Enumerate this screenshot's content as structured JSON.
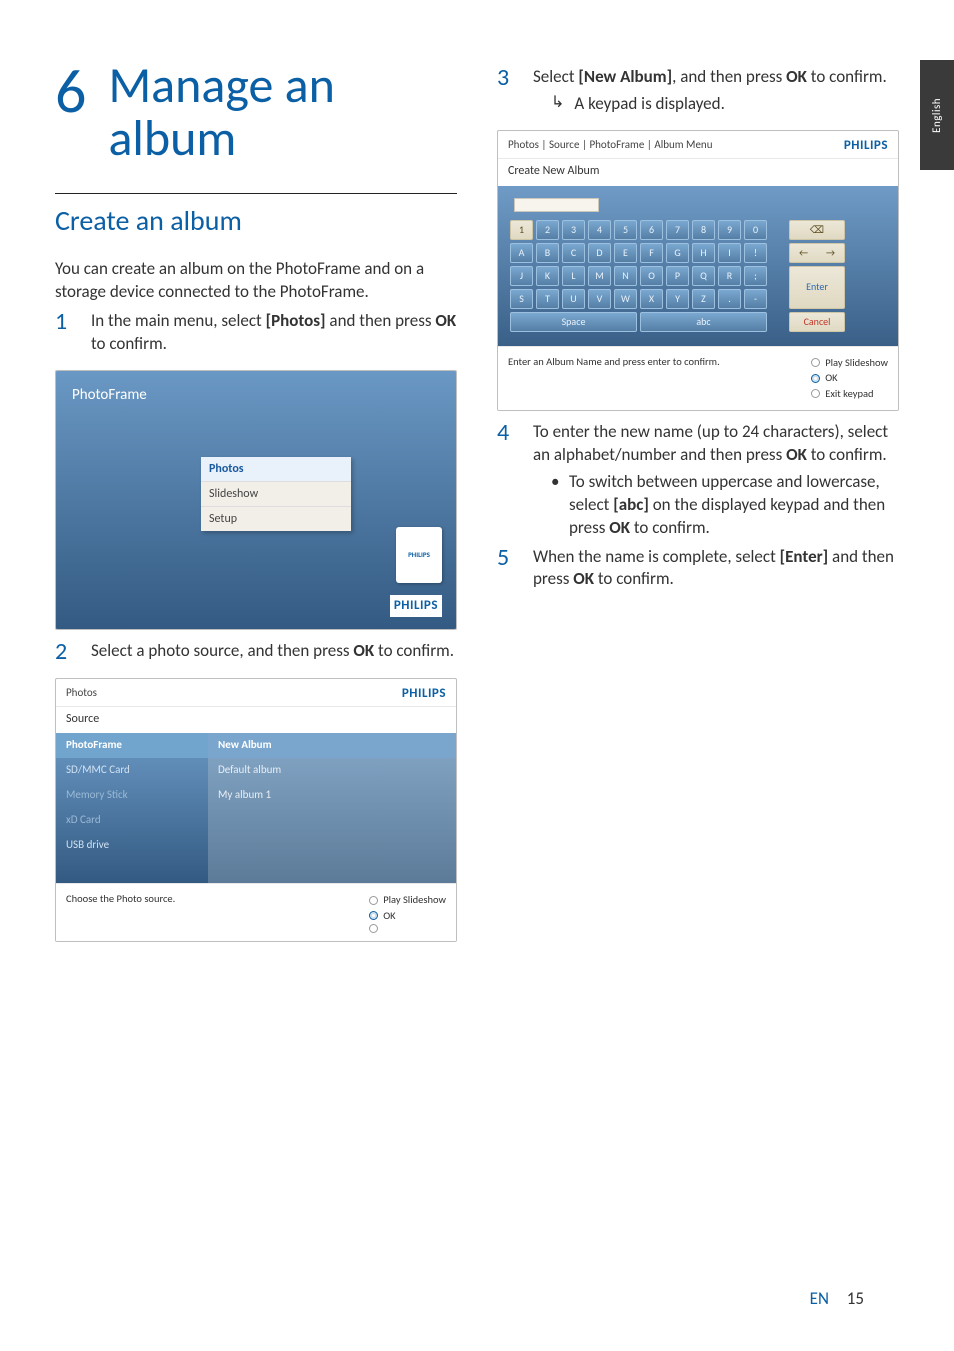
{
  "sideTab": "English",
  "chapter": {
    "number": "6",
    "title_line1": "Manage an",
    "title_line2": "album"
  },
  "section": {
    "title": "Create an album"
  },
  "intro": "You can create an album on the PhotoFrame and on a storage device connected to the PhotoFrame.",
  "steps": {
    "s1_a": "In the main menu, select ",
    "s1_bold": "[Photos]",
    "s1_b": " and then press ",
    "s1_ok": "OK",
    "s1_c": " to confirm.",
    "s2_a": "Select a photo source, and then press ",
    "s2_ok": "OK",
    "s2_b": " to confirm.",
    "s3_a": "Select ",
    "s3_bold": "[New Album]",
    "s3_b": ", and then press ",
    "s3_ok": "OK",
    "s3_c": " to confirm.",
    "s3_result": "A keypad is displayed.",
    "s4_a": "To enter the new name (up to 24 characters), select an alphabet/number and then press ",
    "s4_ok": "OK",
    "s4_b": " to confirm.",
    "s4_bullet_a": "To switch between uppercase and lowercase, select ",
    "s4_bullet_bold": "[abc]",
    "s4_bullet_b": " on the displayed keypad and then press ",
    "s4_bullet_ok": "OK",
    "s4_bullet_c": " to confirm.",
    "s5_a": "When the name is complete, select ",
    "s5_bold": "[Enter]",
    "s5_b": " and then press ",
    "s5_ok": "OK",
    "s5_c": " to confirm."
  },
  "shot1": {
    "title": "PhotoFrame",
    "menu": [
      "Photos",
      "Slideshow",
      "Setup"
    ],
    "frameLogo": "PHILIPS",
    "brand": "PHILIPS"
  },
  "shot2": {
    "breadcrumb": "Photos",
    "brand": "PHILIPS",
    "subhead": "Source",
    "left": [
      "PhotoFrame",
      "SD/MMC Card",
      "Memory Stick",
      "xD Card",
      "USB drive"
    ],
    "right": [
      "New Album",
      "Default album",
      "My album 1"
    ],
    "footMsg": "Choose the Photo source.",
    "act1": "Play Slideshow",
    "act2": "OK"
  },
  "shot3": {
    "breadcrumb": "Photos | Source | PhotoFrame | Album Menu",
    "brand": "PHILIPS",
    "subhead": "Create New Album",
    "rows": [
      [
        "1",
        "2",
        "3",
        "4",
        "5",
        "6",
        "7",
        "8",
        "9",
        "0"
      ],
      [
        "A",
        "B",
        "C",
        "D",
        "E",
        "F",
        "G",
        "H",
        "I",
        "!"
      ],
      [
        "J",
        "K",
        "L",
        "M",
        "N",
        "O",
        "P",
        "Q",
        "R",
        ";"
      ],
      [
        "S",
        "T",
        "U",
        "V",
        "W",
        "X",
        "Y",
        "Z",
        ".",
        "-"
      ]
    ],
    "space": "Space",
    "abc": "abc",
    "backspace": "⌫",
    "left": "←",
    "right": "→",
    "enter": "Enter",
    "cancel": "Cancel",
    "footMsg": "Enter an Album Name and press enter to confirm.",
    "act1": "Play Slideshow",
    "act2": "OK",
    "act3": "Exit keypad"
  },
  "footer": {
    "lang": "EN",
    "page": "15"
  }
}
